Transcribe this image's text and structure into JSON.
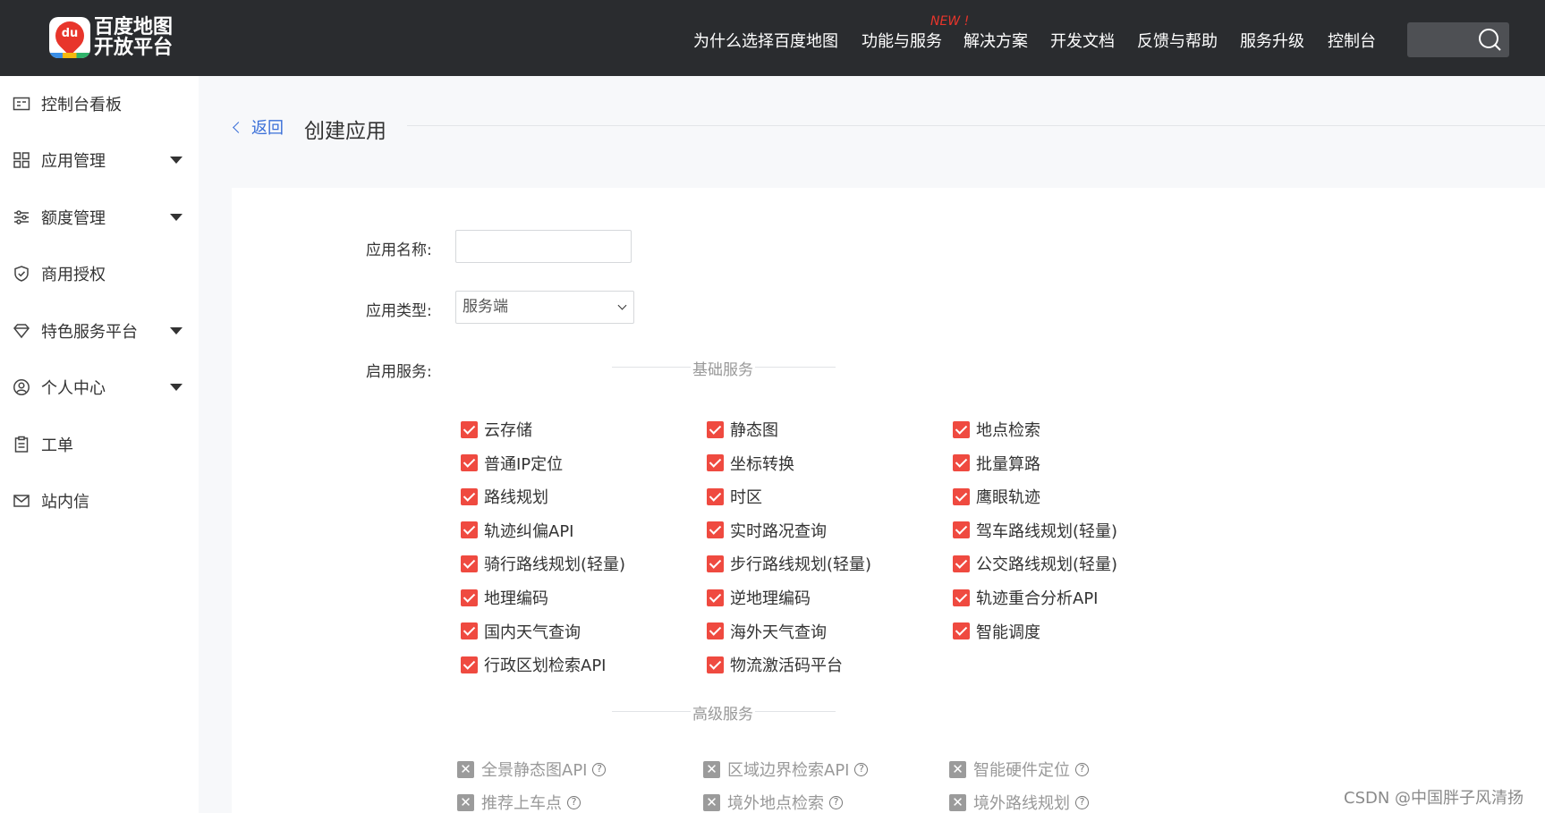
{
  "header": {
    "logo_text_line1": "百度地图",
    "logo_text_line2": "开放平台",
    "logo_badge": "du",
    "nav": [
      {
        "label": "为什么选择百度地图"
      },
      {
        "label": "功能与服务",
        "badge": "NEW !"
      },
      {
        "label": "解决方案"
      },
      {
        "label": "开发文档"
      },
      {
        "label": "反馈与帮助"
      },
      {
        "label": "服务升级"
      },
      {
        "label": "控制台"
      }
    ],
    "search_icon": "search-icon"
  },
  "sidebar": {
    "items": [
      {
        "label": "控制台看板",
        "icon": "dashboard-icon",
        "expandable": false
      },
      {
        "label": "应用管理",
        "icon": "grid-icon",
        "expandable": true
      },
      {
        "label": "额度管理",
        "icon": "sliders-icon",
        "expandable": true
      },
      {
        "label": "商用授权",
        "icon": "shield-icon",
        "expandable": false
      },
      {
        "label": "特色服务平台",
        "icon": "diamond-icon",
        "expandable": true
      },
      {
        "label": "个人中心",
        "icon": "user-icon",
        "expandable": true
      },
      {
        "label": "工单",
        "icon": "clipboard-icon",
        "expandable": false
      },
      {
        "label": "站内信",
        "icon": "mail-icon",
        "expandable": false
      }
    ]
  },
  "page": {
    "back_label": "返回",
    "title": "创建应用"
  },
  "form": {
    "name_label": "应用名称:",
    "name_value": "",
    "type_label": "应用类型:",
    "type_value": "服务端",
    "services_label": "启用服务:",
    "basic_section": "基础服务",
    "advanced_section": "高级服务",
    "basic_services": [
      [
        "云存储",
        "静态图",
        "地点检索"
      ],
      [
        "普通IP定位",
        "坐标转换",
        "批量算路"
      ],
      [
        "路线规划",
        "时区",
        "鹰眼轨迹"
      ],
      [
        "轨迹纠偏API",
        "实时路况查询",
        "驾车路线规划(轻量)"
      ],
      [
        "骑行路线规划(轻量)",
        "步行路线规划(轻量)",
        "公交路线规划(轻量)"
      ],
      [
        "地理编码",
        "逆地理编码",
        "轨迹重合分析API"
      ],
      [
        "国内天气查询",
        "海外天气查询",
        "智能调度"
      ],
      [
        "行政区划检索API",
        "物流激活码平台"
      ]
    ],
    "basic_checked": true,
    "advanced_services": [
      [
        "全景静态图API",
        "区域边界检索API",
        "智能硬件定位"
      ],
      [
        "推荐上车点",
        "境外地点检索",
        "境外路线规划"
      ]
    ],
    "advanced_checked": false,
    "colors": {
      "checked": "#ef4a40",
      "disabled": "#9b9b9b",
      "link": "#3a6fd8",
      "topbar": "#2a2c2f"
    }
  },
  "watermark": "CSDN @中国胖子风清扬"
}
